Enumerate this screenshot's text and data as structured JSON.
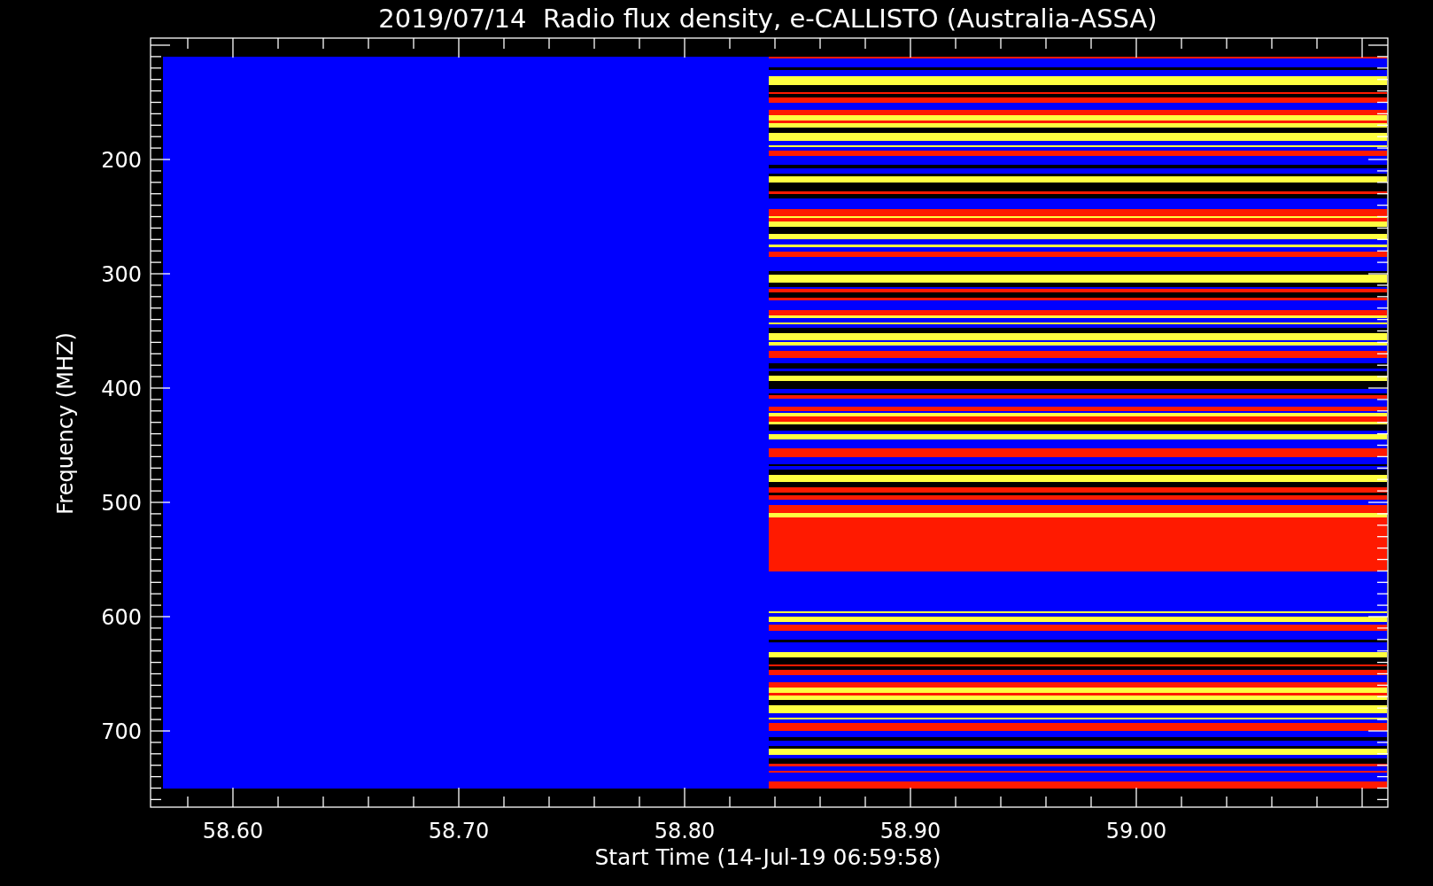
{
  "plot": {
    "title": "2019/07/14  Radio flux density, e-CALLISTO (Australia-ASSA)",
    "x_axis": {
      "label": "Start Time (14-Jul-19 06:59:58)",
      "ticks": [
        "58.60",
        "58.70",
        "58.80",
        "58.90",
        "59.00"
      ]
    },
    "y_axis": {
      "label": "Frequency (MHZ)",
      "ticks": [
        "200",
        "300",
        "400",
        "500",
        "600",
        "700"
      ]
    }
  }
}
